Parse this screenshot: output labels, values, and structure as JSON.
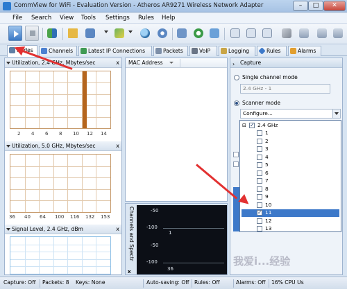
{
  "window": {
    "title": "CommView for WiFi - Evaluation Version - Atheros AR9271 Wireless Network Adapter",
    "min_label": "–",
    "max_label": "□",
    "close_label": "✕"
  },
  "menu": [
    "File",
    "Search",
    "View",
    "Tools",
    "Settings",
    "Rules",
    "Help"
  ],
  "tabs": [
    "Nodes",
    "Channels",
    "Latest IP Connections",
    "Packets",
    "VoIP",
    "Logging",
    "Rules",
    "Alarms"
  ],
  "graphs": {
    "util24": {
      "title": "Utilization, 2.4 GHz, Mbytes/sec",
      "ticks": [
        "2",
        "4",
        "6",
        "8",
        "10",
        "12",
        "14"
      ],
      "active_channel": 11
    },
    "util50": {
      "title": "Utilization, 5.0 GHz, Mbytes/sec",
      "ticks": [
        "36",
        "40",
        "64",
        "100",
        "116",
        "132",
        "153"
      ]
    },
    "signal24": {
      "title": "Signal Level, 2.4 GHz, dBm"
    }
  },
  "mac_list": {
    "header": "MAC Address"
  },
  "spectrum": {
    "title": "Channels and Spectr",
    "close": "x",
    "levels": [
      "-50",
      "-100",
      "-50",
      "-100"
    ],
    "ticks": [
      "1",
      "36"
    ]
  },
  "capture": {
    "header": "Capture",
    "single_mode_label": "Single channel mode",
    "single_mode_value": "2.4 GHz - 1",
    "scanner_mode_label": "Scanner mode",
    "configure_label": "Configure...",
    "band_label": "2.4 GHz",
    "channels": [
      {
        "label": "1",
        "checked": false
      },
      {
        "label": "2",
        "checked": false
      },
      {
        "label": "3",
        "checked": false
      },
      {
        "label": "4",
        "checked": false
      },
      {
        "label": "5",
        "checked": false
      },
      {
        "label": "6",
        "checked": false
      },
      {
        "label": "7",
        "checked": false
      },
      {
        "label": "8",
        "checked": false
      },
      {
        "label": "9",
        "checked": false
      },
      {
        "label": "10",
        "checked": false
      },
      {
        "label": "11",
        "checked": true
      },
      {
        "label": "12",
        "checked": false
      },
      {
        "label": "13",
        "checked": false
      }
    ],
    "selected_channel": "11"
  },
  "status": {
    "capture": "Capture: Off",
    "packets": "Packets: 8",
    "keys": "Keys: None",
    "autosave": "Auto-saving: Off",
    "rules": "Rules: Off",
    "alarms": "Alarms: Off",
    "cpu": "16% CPU Us"
  },
  "watermark": "我爱i...经验",
  "colors": {
    "accent": "#3d79c9",
    "graph_bar": "#b5651d",
    "annotation_arrow": "#e23131"
  }
}
